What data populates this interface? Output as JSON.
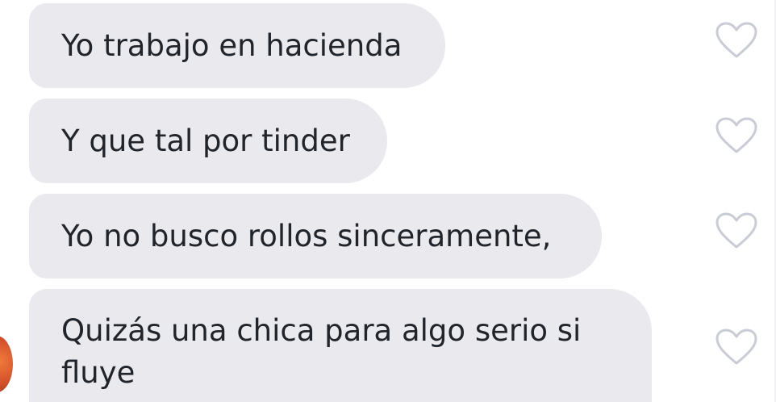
{
  "messages": [
    {
      "text": "Yo trabajo en hacienda",
      "icon": "heart-outline-icon"
    },
    {
      "text": "Y que tal por tinder",
      "icon": "heart-outline-icon"
    },
    {
      "text": "Yo no busco rollos sinceramente,",
      "icon": "heart-outline-icon"
    },
    {
      "text": "Quizás una chica para algo serio si fluye",
      "icon": "heart-outline-icon"
    }
  ],
  "colors": {
    "bubble_bg": "#e9e9ee",
    "text": "#21242b",
    "heart_stroke": "#c9ccd4",
    "avatar": "#e0622f"
  }
}
